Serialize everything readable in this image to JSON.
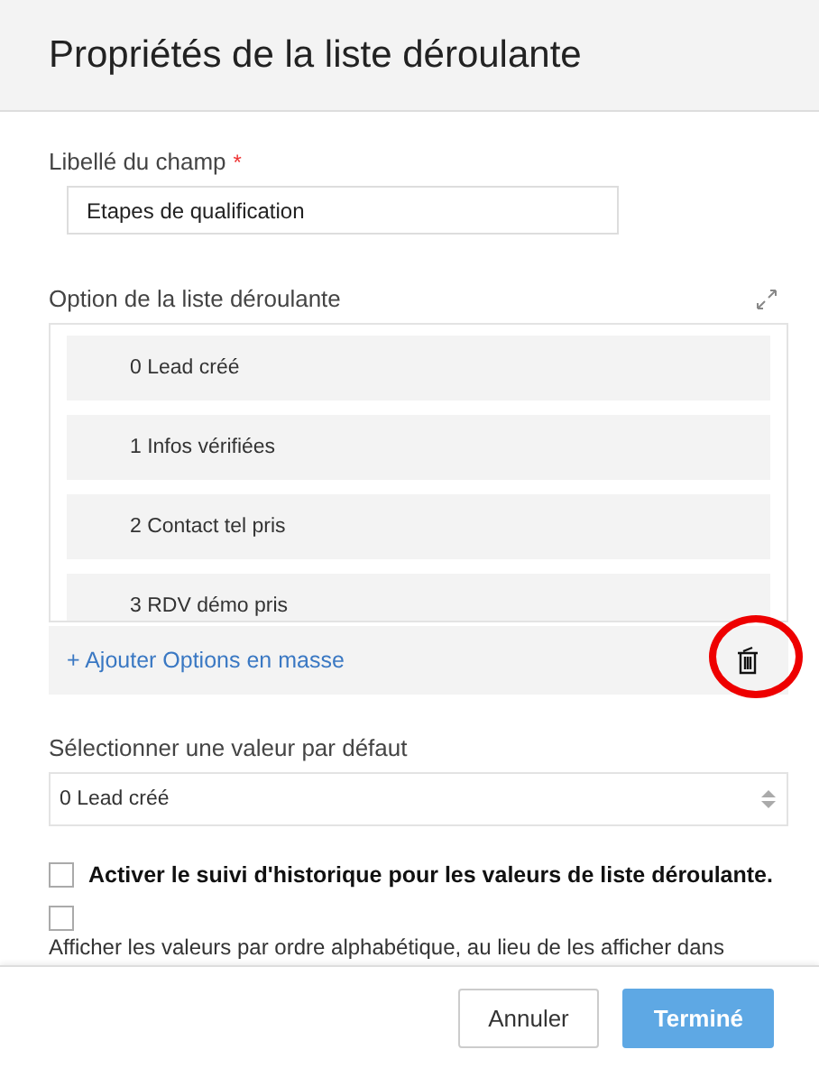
{
  "dialog": {
    "title": "Propriétés de la liste déroulante"
  },
  "field_label": {
    "label": "Libellé du champ",
    "required_mark": "*",
    "value": "Etapes de qualification"
  },
  "options_section": {
    "label": "Option de la liste déroulante",
    "options": [
      {
        "text": "0 Lead créé"
      },
      {
        "text": "1 Infos vérifiées"
      },
      {
        "text": "2 Contact tel pris"
      },
      {
        "text": "3 RDV démo pris"
      }
    ],
    "add_bulk_link": "+ Ajouter Options en masse"
  },
  "default_value": {
    "label": "Sélectionner une valeur par défaut",
    "value": "0 Lead créé"
  },
  "checkboxes": [
    {
      "label": "Activer le suivi d'historique pour les valeurs de liste déroulante.",
      "checked": false,
      "kind": "inline"
    },
    {
      "label": "Afficher les valeurs par ordre alphabétique, au lieu de les afficher dans",
      "checked": false,
      "kind": "stacked"
    }
  ],
  "buttons": [
    {
      "label": "Annuler",
      "kind": "secondary"
    },
    {
      "label": "Terminé",
      "kind": "primary",
      "disabled": true
    }
  ]
}
